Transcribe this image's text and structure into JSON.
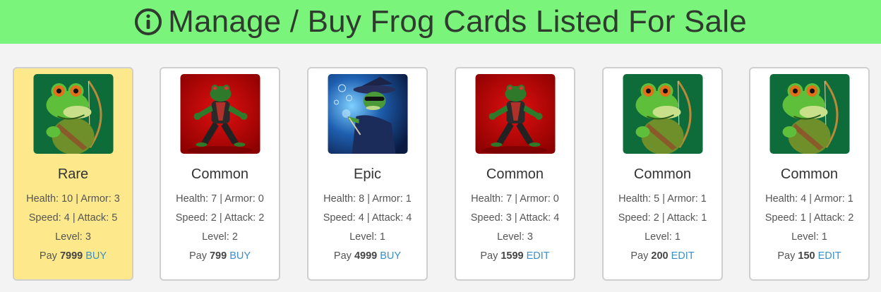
{
  "header": {
    "title": "Manage / Buy Frog Cards Listed For Sale",
    "icon": "info-circle-icon",
    "background_color": "#7af47a"
  },
  "labels": {
    "health": "Health: ",
    "armor": " | Armor: ",
    "speed": "Speed: ",
    "attack": " | Attack: ",
    "level": "Level: ",
    "pay": "Pay "
  },
  "cards": [
    {
      "image": "archer-frog",
      "rarity": "Rare",
      "health": "10",
      "armor": "3",
      "speed": "4",
      "attack": "5",
      "level": "3",
      "price": "7999",
      "action": "BUY",
      "selected": true
    },
    {
      "image": "fighter-frog",
      "rarity": "Common",
      "health": "7",
      "armor": "0",
      "speed": "2",
      "attack": "2",
      "level": "2",
      "price": "799",
      "action": "BUY",
      "selected": false
    },
    {
      "image": "wizard-frog",
      "rarity": "Epic",
      "health": "8",
      "armor": "1",
      "speed": "4",
      "attack": "4",
      "level": "1",
      "price": "4999",
      "action": "BUY",
      "selected": false
    },
    {
      "image": "fighter-frog",
      "rarity": "Common",
      "health": "7",
      "armor": "0",
      "speed": "3",
      "attack": "4",
      "level": "3",
      "price": "1599",
      "action": "EDIT",
      "selected": false
    },
    {
      "image": "archer-frog",
      "rarity": "Common",
      "health": "5",
      "armor": "1",
      "speed": "2",
      "attack": "1",
      "level": "1",
      "price": "200",
      "action": "EDIT",
      "selected": false
    },
    {
      "image": "archer-frog",
      "rarity": "Common",
      "health": "4",
      "armor": "1",
      "speed": "1",
      "attack": "2",
      "level": "1",
      "price": "150",
      "action": "EDIT",
      "selected": false
    }
  ],
  "colors": {
    "selected_card": "#fde98c",
    "link": "#3a8fc9"
  }
}
